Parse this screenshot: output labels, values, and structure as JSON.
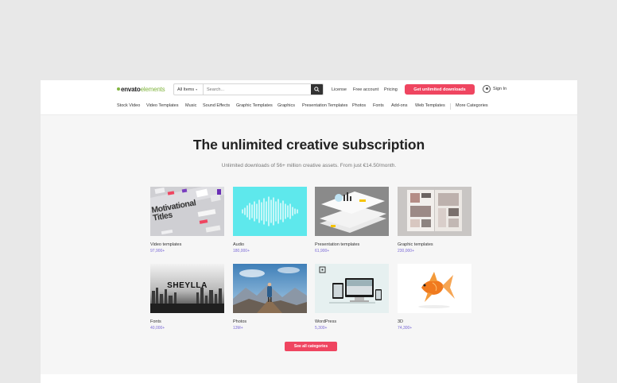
{
  "header": {
    "logo_primary": "envato",
    "logo_secondary": "elements",
    "search_category": "All Items",
    "search_placeholder": "Search...",
    "nav": [
      "License",
      "Free account",
      "Pricing"
    ],
    "cta_label": "Get unlimited downloads",
    "signin_label": "Sign In"
  },
  "categories": [
    "Stock Video",
    "Video Templates",
    "Music",
    "Sound Effects",
    "Graphic Templates",
    "Graphics",
    "Presentation Templates",
    "Photos",
    "Fonts",
    "Add-ons",
    "Web Templates",
    "More Categories"
  ],
  "hero": {
    "title": "The unlimited creative subscription",
    "subtitle": "Unlimited downloads of 56+ million creative assets. From just €14.50/month."
  },
  "cards": [
    {
      "title": "Video templates",
      "count": "97,900+",
      "thumb_text": "Motivational Titles"
    },
    {
      "title": "Audio",
      "count": "180,000+"
    },
    {
      "title": "Presentation templates",
      "count": "61,900+"
    },
    {
      "title": "Graphic templates",
      "count": "230,000+"
    },
    {
      "title": "Fonts",
      "count": "40,000+",
      "thumb_text": "SHEYLLA"
    },
    {
      "title": "Photos",
      "count": "13M+"
    },
    {
      "title": "WordPress",
      "count": "5,300+"
    },
    {
      "title": "3D",
      "count": "74,300+"
    }
  ],
  "see_all_label": "See all categories",
  "colors": {
    "accent": "#ef4560",
    "logo_green": "#82b541",
    "count_purple": "#7b6ad6",
    "audio_bg": "#5ee8ec"
  }
}
